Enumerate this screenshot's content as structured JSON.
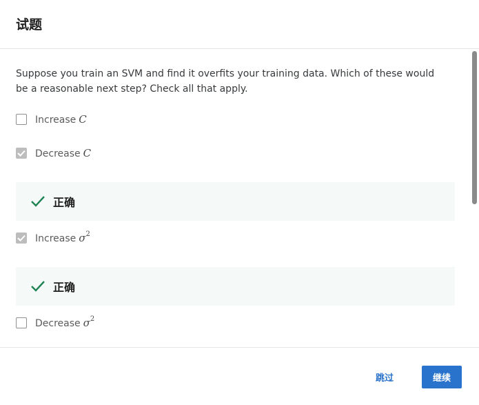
{
  "header": {
    "title": "试题"
  },
  "question": {
    "text": "Suppose you train an SVM and find it overfits your training data. Which of these would be a reasonable next step? Check all that apply."
  },
  "options": [
    {
      "label": "Increase",
      "math": "C",
      "sup": "",
      "checked": false
    },
    {
      "label": "Decrease",
      "math": "C",
      "sup": "",
      "checked": true
    },
    {
      "label": "Increase",
      "math": "σ",
      "sup": "2",
      "checked": true
    },
    {
      "label": "Decrease",
      "math": "σ",
      "sup": "2",
      "checked": false
    }
  ],
  "feedback": [
    {
      "label": "正确",
      "icon": "checkmark-icon",
      "color": "#1f8354"
    },
    {
      "label": "正确",
      "icon": "checkmark-icon",
      "color": "#1f8354"
    }
  ],
  "footer": {
    "skip_label": "跳过",
    "continue_label": "继续"
  },
  "colors": {
    "accent": "#2a73cc",
    "correct": "#1f8354",
    "feedback_bg": "#f5f9f7"
  }
}
